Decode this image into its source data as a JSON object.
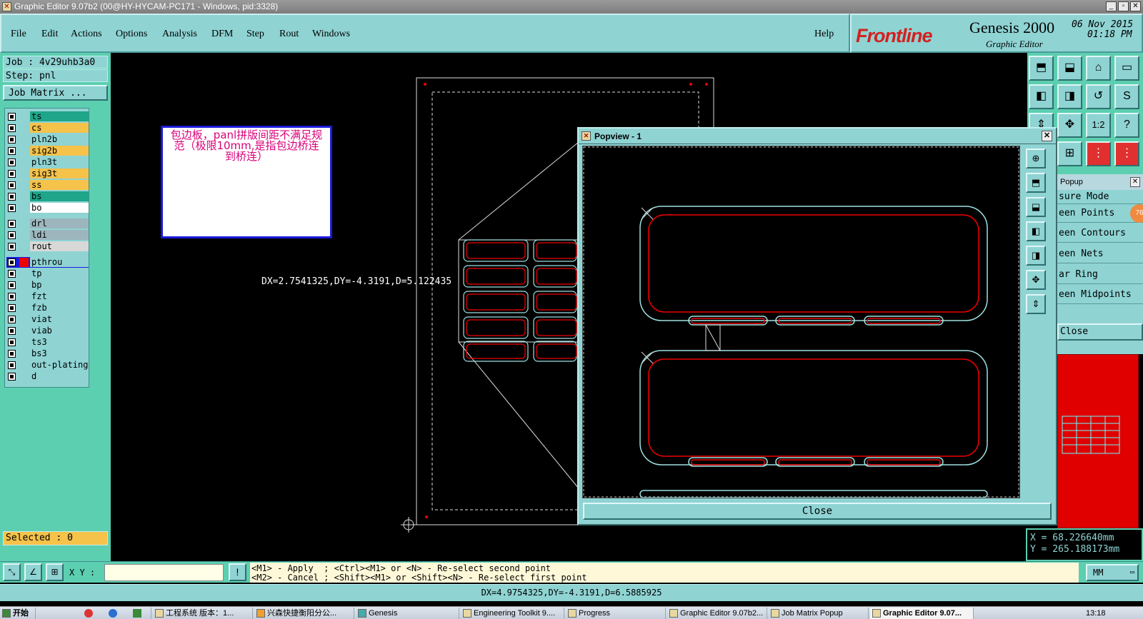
{
  "window": {
    "title": "Graphic Editor 9.07b2 (00@HY-HYCAM-PC171 - Windows, pid:3328)",
    "app_icon_glyph": "✕",
    "controls": [
      "_",
      "▫",
      "✕"
    ]
  },
  "menu": {
    "items": [
      "File",
      "Edit",
      "Actions",
      "Options",
      "Analysis",
      "DFM",
      "Step",
      "Rout",
      "Windows"
    ],
    "help": "Help"
  },
  "logo": {
    "brand": "Frontline",
    "product": "Genesis 2000",
    "subtitle": "Graphic Editor",
    "date": "06 Nov 2015",
    "time": "01:18 PM"
  },
  "left": {
    "job": "Job : 4v29uhb3a0",
    "step": "Step: pnl",
    "job_matrix": "Job Matrix ...",
    "selected": "Selected : 0",
    "layers": [
      {
        "name": "ts",
        "color": "#1fa58a"
      },
      {
        "name": "cs",
        "color": "#f5c24a"
      },
      {
        "name": "pln2b",
        "color": "#8fd3d3"
      },
      {
        "name": "sig2b",
        "color": "#f5c24a"
      },
      {
        "name": "pln3t",
        "color": "#8fd3d3"
      },
      {
        "name": "sig3t",
        "color": "#f5c24a"
      },
      {
        "name": "ss",
        "color": "#f5c24a"
      },
      {
        "name": "bs",
        "color": "#1fa58a"
      },
      {
        "name": "bo",
        "color": "#ffffff"
      },
      {
        "name": "drl",
        "color": "#9db6bd"
      },
      {
        "name": "ldi",
        "color": "#9db6bd"
      },
      {
        "name": "rout",
        "color": "#d8d8d8"
      },
      {
        "name": "pthrou",
        "color": "#8fd3d3"
      },
      {
        "name": "tp",
        "color": "#8fd3d3"
      },
      {
        "name": "bp",
        "color": "#8fd3d3"
      },
      {
        "name": "fzt",
        "color": "#8fd3d3"
      },
      {
        "name": "fzb",
        "color": "#8fd3d3"
      },
      {
        "name": "viat",
        "color": "#8fd3d3"
      },
      {
        "name": "viab",
        "color": "#8fd3d3"
      },
      {
        "name": "ts3",
        "color": "#8fd3d3"
      },
      {
        "name": "bs3",
        "color": "#8fd3d3"
      },
      {
        "name": "out-plating",
        "color": "#8fd3d3"
      },
      {
        "name": "d",
        "color": "#8fd3d3"
      }
    ]
  },
  "canvas": {
    "note": "包边板，panl拼版间距不满足规范（极限10mm,是指包边桥连到桥连）",
    "measure_readout": "DX=2.7541325,DY=-4.3191,D=5.122435"
  },
  "popview": {
    "title": "Popview - 1",
    "close_label": "Close"
  },
  "measure_popup": {
    "title": "Popup",
    "items": [
      "sure Mode",
      "een Points",
      "een Contours",
      "een Nets",
      "ar Ring",
      "een Midpoints"
    ],
    "close": "Close",
    "badge": "76"
  },
  "coords": {
    "x": "X = 68.226640mm",
    "y": "Y = 265.188173mm"
  },
  "command": {
    "xy_label": "X Y :",
    "xy_value": "",
    "hint1": "<M1> - Apply  ; <Ctrl><M1> or <N> - Re-select second point",
    "hint2": "<M2> - Cancel ; <Shift><M1> or <Shift><N> - Re-select first point",
    "units": "MM",
    "status": "DX=4.9754325,DY=-4.3191,D=6.5885925"
  },
  "taskbar": {
    "start": "开始",
    "tasks": [
      "工程系统  版本：1...",
      "兴森快捷衡阳分公...",
      "Genesis",
      "Engineering Toolkit 9....",
      "Progress",
      "Graphic Editor 9.07b2...",
      "Job Matrix Popup",
      "Graphic Editor 9.07..."
    ],
    "clock": "13:18"
  },
  "colors": {
    "panel_teal": "#8fd3d3",
    "panel_green": "#5ccfb0",
    "selected_bar": "#f5c24a",
    "feature_red": "#e00000",
    "feature_cyan": "#9fe0e0"
  }
}
